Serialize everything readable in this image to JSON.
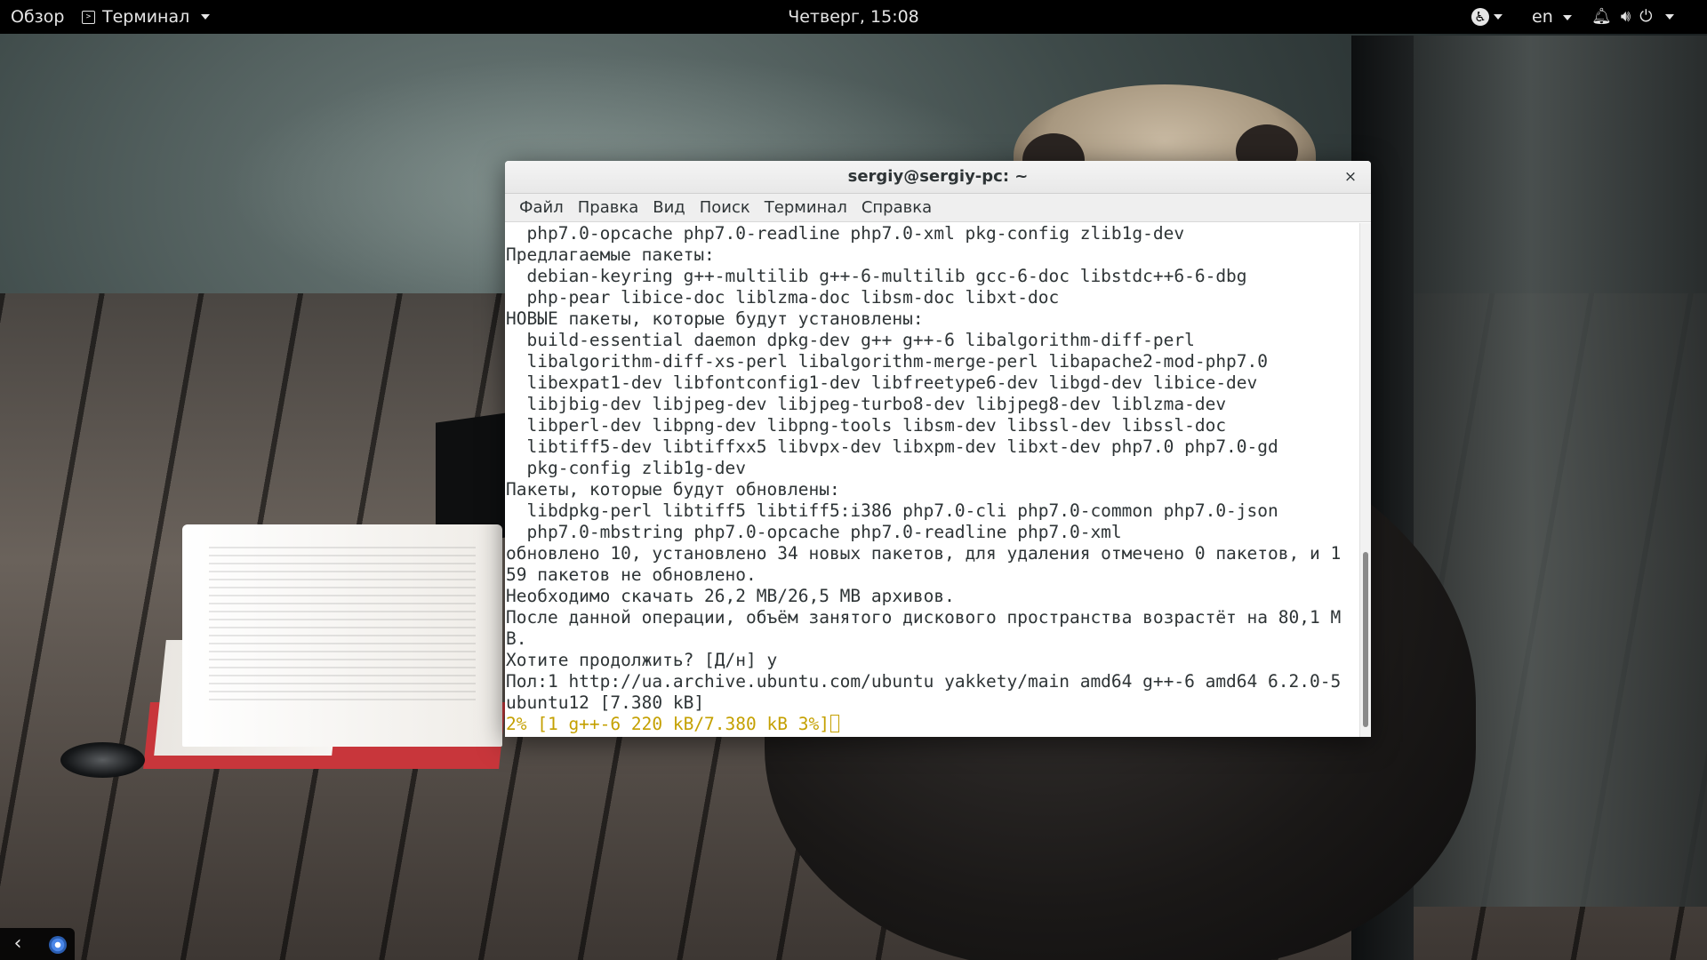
{
  "topbar": {
    "activities": "Обзор",
    "app_menu_label": "Терминал",
    "clock": "Четверг, 15:08",
    "language": "en",
    "icons": [
      "accessibility-icon",
      "notification-bell-icon",
      "volume-icon",
      "power-icon"
    ]
  },
  "terminal": {
    "title": "sergiy@sergiy-pc: ~",
    "close_glyph": "×",
    "menu": [
      "Файл",
      "Правка",
      "Вид",
      "Поиск",
      "Терминал",
      "Справка"
    ],
    "lines": [
      "  php7.0-opcache php7.0-readline php7.0-xml pkg-config zlib1g-dev",
      "Предлагаемые пакеты:",
      "  debian-keyring g++-multilib g++-6-multilib gcc-6-doc libstdc++6-6-dbg",
      "  php-pear libice-doc liblzma-doc libsm-doc libxt-doc",
      "НОВЫЕ пакеты, которые будут установлены:",
      "  build-essential daemon dpkg-dev g++ g++-6 libalgorithm-diff-perl",
      "  libalgorithm-diff-xs-perl libalgorithm-merge-perl libapache2-mod-php7.0",
      "  libexpat1-dev libfontconfig1-dev libfreetype6-dev libgd-dev libice-dev",
      "  libjbig-dev libjpeg-dev libjpeg-turbo8-dev libjpeg8-dev liblzma-dev",
      "  libperl-dev libpng-dev libpng-tools libsm-dev libssl-dev libssl-doc",
      "  libtiff5-dev libtiffxx5 libvpx-dev libxpm-dev libxt-dev php7.0 php7.0-gd",
      "  pkg-config zlib1g-dev",
      "Пакеты, которые будут обновлены:",
      "  libdpkg-perl libtiff5 libtiff5:i386 php7.0-cli php7.0-common php7.0-json",
      "  php7.0-mbstring php7.0-opcache php7.0-readline php7.0-xml",
      "обновлено 10, установлено 34 новых пакетов, для удаления отмечено 0 пакетов, и 1",
      "59 пакетов не обновлено.",
      "Необходимо скачать 26,2 MB/26,5 MB архивов.",
      "После данной операции, объём занятого дискового пространства возрастёт на 80,1 M",
      "B.",
      "Хотите продолжить? [Д/н] y",
      "Пол:1 http://ua.archive.ubuntu.com/ubuntu yakkety/main amd64 g++-6 amd64 6.2.0-5",
      "ubuntu12 [7.380 kB]"
    ],
    "progress_line": "2% [1 g++-6 220 kB/7.380 kB 3%]",
    "scroll_position": 0.97,
    "scroll_visible_fraction": 0.34,
    "progress_color": "#c4a000"
  },
  "bottom_tray": {
    "icons": [
      "chevron-left-icon",
      "chrome-icon"
    ]
  }
}
